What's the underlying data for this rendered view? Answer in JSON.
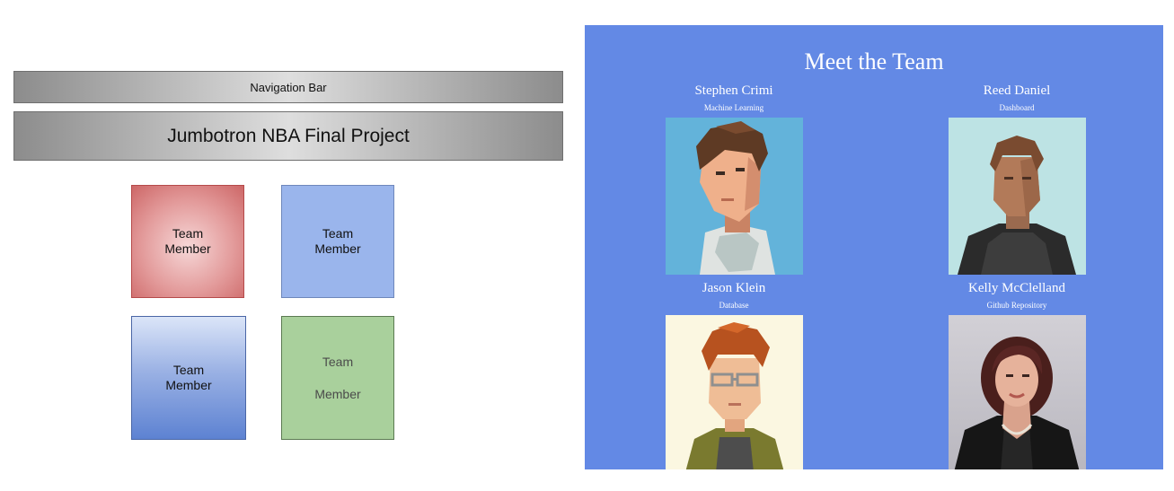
{
  "wireframe": {
    "nav_label": "Navigation Bar",
    "jumbotron_label": "Jumbotron NBA Final Project",
    "tiles": [
      {
        "line1": "Team",
        "line2": "Member",
        "color": "#e39b9b"
      },
      {
        "line1": "Team",
        "line2": "Member",
        "color": "#9ab5ec"
      },
      {
        "line1": "Team",
        "line2": "Member",
        "color": "#7e9ee0"
      },
      {
        "line1": "Team",
        "line2": "Member",
        "color": "#a9d09c"
      }
    ]
  },
  "site": {
    "background": "#6389e5",
    "title": "Meet the Team",
    "members": [
      {
        "name": "Stephen Crimi",
        "role": "Machine Learning",
        "photo_icon": "pixel-avatar-icon",
        "photo_bg": "#63b3da"
      },
      {
        "name": "Reed Daniel",
        "role": "Dashboard",
        "photo_icon": "pixel-avatar-icon",
        "photo_bg": "#bde3e4"
      },
      {
        "name": "Jason Klein",
        "role": "Database",
        "photo_icon": "pixel-avatar-icon",
        "photo_bg": "#fbf7e1"
      },
      {
        "name": "Kelly McClelland",
        "role": "Github Repository",
        "photo_icon": "person-photo-icon",
        "photo_bg": "#c4c2c8"
      }
    ]
  }
}
